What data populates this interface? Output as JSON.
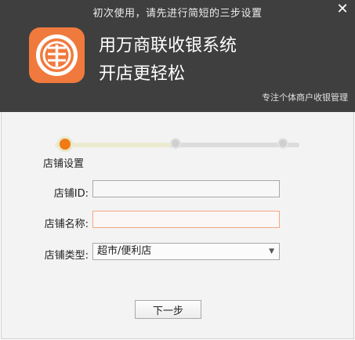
{
  "window": {
    "title": "初次使用，请先进行简短的三步设置",
    "close_icon": "✕"
  },
  "brand": {
    "logo_glyph": "¥",
    "line1": "用万商联收银系统",
    "line2": "开店更轻松",
    "tagline": "专注个体商户收银管理",
    "accent_color": "#f07a3d"
  },
  "steps": {
    "current": 1,
    "total": 3,
    "current_label": "店铺设置"
  },
  "form": {
    "store_id": {
      "label": "店铺ID:",
      "value": ""
    },
    "store_name": {
      "label": "店铺名称:",
      "value": ""
    },
    "store_type": {
      "label": "店铺类型:",
      "selected": "超市/便利店"
    }
  },
  "actions": {
    "next_label": "下一步"
  }
}
